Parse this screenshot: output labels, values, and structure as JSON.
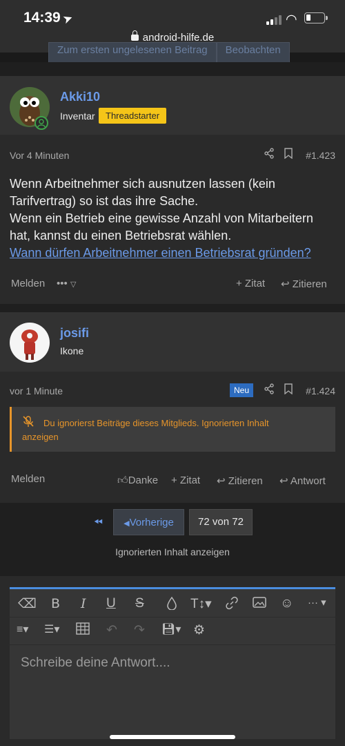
{
  "status_bar": {
    "time": "14:39",
    "url": "android-hilfe.de"
  },
  "top_buttons": {
    "first_unread": "Zum ersten ungelesenen Beitrag",
    "watch": "Beobachten"
  },
  "post1": {
    "username": "Akki10",
    "user_title": "Inventar",
    "badge": "Threadstarter",
    "time": "Vor 4 Minuten",
    "post_number": "#1.423",
    "lines": [
      "Wenn Arbeitnehmer sich ausnutzen lassen (kein",
      "Tarifvertrag) so ist das ihre Sache.",
      "Wenn ein Betrieb eine gewisse Anzahl von Mitarbeitern",
      "hat, kannst du einen Betriebsrat wählen."
    ],
    "link": "Wann dürfen Arbeitnehmer einen Betriebsrat gründen?",
    "actions": {
      "report": "Melden",
      "more": "•••",
      "quote_add": "+ Zitat",
      "quote": "Zitieren"
    }
  },
  "post2": {
    "username": "josifi",
    "user_title": "Ikone",
    "time": "vor 1 Minute",
    "new_badge": "Neu",
    "post_number": "#1.424",
    "notice_text": "Du ignorierst Beiträge dieses Mitglieds.",
    "notice_link_1": "Ignorierten Inhalt",
    "notice_link_2": "anzeigen",
    "actions": {
      "report": "Melden",
      "like": "Danke",
      "quote_add": "+ Zitat",
      "quote": "Zitieren",
      "reply": "Antwort"
    }
  },
  "pagination": {
    "prev": "Vorherige",
    "count": "72 von 72",
    "show_ignored": "Ignorierten Inhalt anzeigen"
  },
  "editor": {
    "placeholder": "Schreibe deine Antwort...."
  }
}
